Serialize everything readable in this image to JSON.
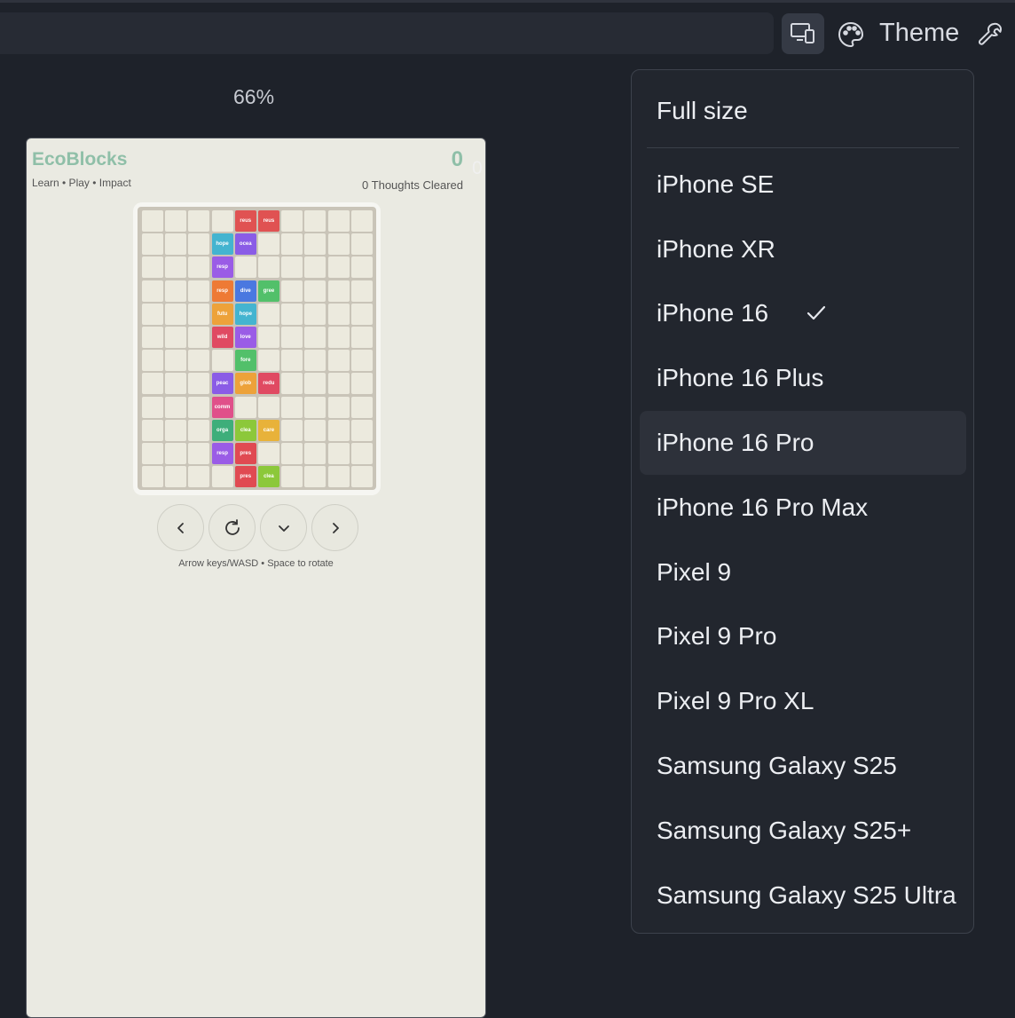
{
  "toolbar": {
    "theme_label": "Theme",
    "device_icon": "devices-icon",
    "palette_icon": "palette-icon",
    "wrench_icon": "wrench-icon"
  },
  "preview": {
    "zoom": "66%",
    "edge_value": "0"
  },
  "app": {
    "title": "EcoBlocks",
    "tagline": "Learn • Play • Impact",
    "score": "0",
    "cleared": "0 Thoughts Cleared",
    "hint": "Arrow keys/WASD • Space to rotate",
    "grid_cols": 10,
    "grid_rows": 12,
    "blocks": [
      {
        "row": 0,
        "col": 4,
        "label": "reus",
        "color": "#e05252"
      },
      {
        "row": 0,
        "col": 5,
        "label": "reus",
        "color": "#e05252"
      },
      {
        "row": 1,
        "col": 3,
        "label": "hope",
        "color": "#44b4d0"
      },
      {
        "row": 1,
        "col": 4,
        "label": "ocea",
        "color": "#8a5ce6"
      },
      {
        "row": 2,
        "col": 3,
        "label": "resp",
        "color": "#9a5ce6"
      },
      {
        "row": 3,
        "col": 3,
        "label": "resp",
        "color": "#ee7a35"
      },
      {
        "row": 3,
        "col": 4,
        "label": "dive",
        "color": "#4a78e0"
      },
      {
        "row": 3,
        "col": 5,
        "label": "gree",
        "color": "#52c06a"
      },
      {
        "row": 4,
        "col": 3,
        "label": "futu",
        "color": "#eda23a"
      },
      {
        "row": 4,
        "col": 4,
        "label": "hope",
        "color": "#44b4d0"
      },
      {
        "row": 5,
        "col": 3,
        "label": "wild",
        "color": "#e04a62"
      },
      {
        "row": 5,
        "col": 4,
        "label": "love",
        "color": "#9a5ce6"
      },
      {
        "row": 6,
        "col": 4,
        "label": "fore",
        "color": "#52c06a"
      },
      {
        "row": 7,
        "col": 3,
        "label": "peac",
        "color": "#8a5ce6"
      },
      {
        "row": 7,
        "col": 4,
        "label": "glob",
        "color": "#eda23a"
      },
      {
        "row": 7,
        "col": 5,
        "label": "redu",
        "color": "#e04a62"
      },
      {
        "row": 8,
        "col": 3,
        "label": "comm",
        "color": "#e0508a"
      },
      {
        "row": 9,
        "col": 3,
        "label": "orga",
        "color": "#3eae7a"
      },
      {
        "row": 9,
        "col": 4,
        "label": "clea",
        "color": "#8cc83a"
      },
      {
        "row": 9,
        "col": 5,
        "label": "care",
        "color": "#e8b23a"
      },
      {
        "row": 10,
        "col": 3,
        "label": "resp",
        "color": "#9a5ce6"
      },
      {
        "row": 10,
        "col": 4,
        "label": "pres",
        "color": "#e04a52"
      },
      {
        "row": 11,
        "col": 4,
        "label": "pres",
        "color": "#e04a52"
      },
      {
        "row": 11,
        "col": 5,
        "label": "clea",
        "color": "#8cc83a"
      }
    ],
    "controls": [
      "chevron-left-icon",
      "rotate-icon",
      "chevron-down-icon",
      "chevron-right-icon"
    ]
  },
  "device_menu": {
    "items": [
      {
        "label": "Full size",
        "selected": false,
        "hovered": false
      },
      {
        "label": "iPhone SE",
        "selected": false,
        "hovered": false
      },
      {
        "label": "iPhone XR",
        "selected": false,
        "hovered": false
      },
      {
        "label": "iPhone 16",
        "selected": true,
        "hovered": false
      },
      {
        "label": "iPhone 16 Plus",
        "selected": false,
        "hovered": false
      },
      {
        "label": "iPhone 16 Pro",
        "selected": false,
        "hovered": true
      },
      {
        "label": "iPhone 16 Pro Max",
        "selected": false,
        "hovered": false
      },
      {
        "label": "Pixel 9",
        "selected": false,
        "hovered": false
      },
      {
        "label": "Pixel 9 Pro",
        "selected": false,
        "hovered": false
      },
      {
        "label": "Pixel 9 Pro XL",
        "selected": false,
        "hovered": false
      },
      {
        "label": "Samsung Galaxy S25",
        "selected": false,
        "hovered": false
      },
      {
        "label": "Samsung Galaxy S25+",
        "selected": false,
        "hovered": false
      },
      {
        "label": "Samsung Galaxy S25 Ultra",
        "selected": false,
        "hovered": false
      }
    ]
  }
}
